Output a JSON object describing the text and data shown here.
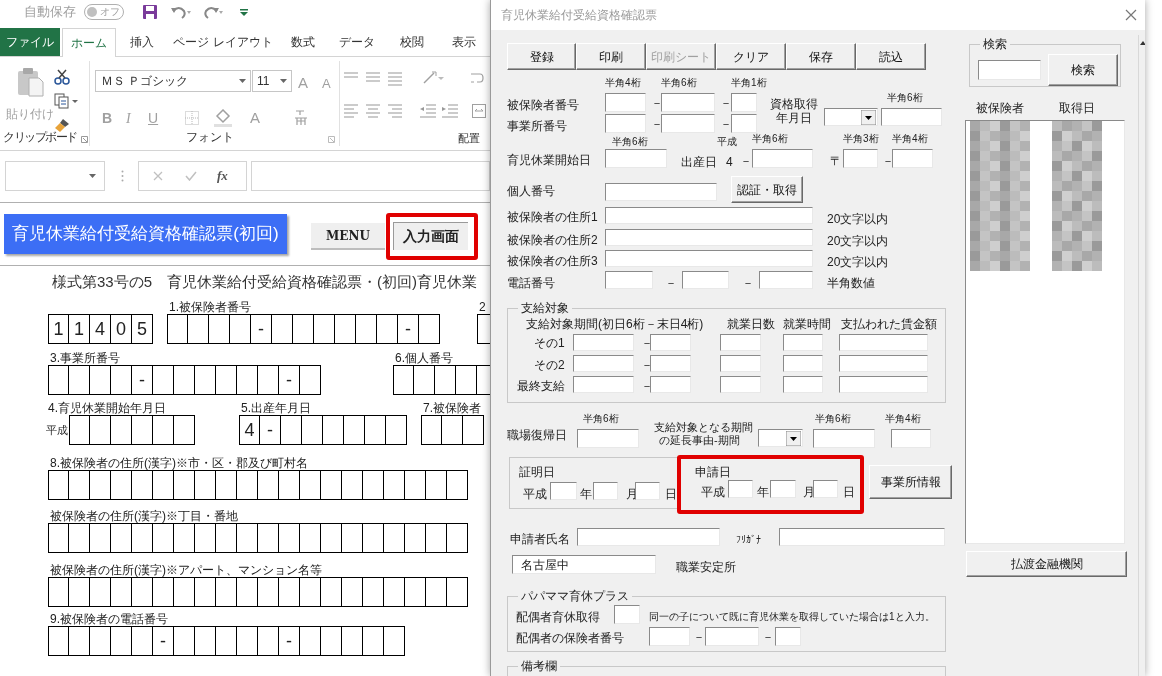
{
  "excel": {
    "quick_access": {
      "autosave_label": "自動保存",
      "autosave_toggle": {
        "label": "オフ",
        "on": false
      }
    },
    "tabs": [
      {
        "label": "ファイル",
        "kind": "file",
        "selected": false
      },
      {
        "label": "ホーム",
        "kind": "tab",
        "selected": true
      },
      {
        "label": "挿入",
        "kind": "tab",
        "selected": false
      },
      {
        "label": "ページ レイアウト",
        "kind": "tab",
        "selected": false
      },
      {
        "label": "数式",
        "kind": "tab",
        "selected": false
      },
      {
        "label": "データ",
        "kind": "tab",
        "selected": false
      },
      {
        "label": "校閲",
        "kind": "tab",
        "selected": false
      },
      {
        "label": "表示",
        "kind": "tab",
        "selected": false
      }
    ],
    "ribbon": {
      "paste_label": "貼り付け",
      "font_name": "ＭＳ Ｐゴシック",
      "font_size": "11",
      "grow_shrink": [
        "A",
        "A"
      ],
      "format_buttons": [
        "B",
        "I",
        "U"
      ],
      "font_color": "A",
      "group_labels": [
        "クリップボード",
        "フォント",
        "配置"
      ]
    },
    "formula_bar": {
      "fx": "fx"
    },
    "sheet": {
      "title_button": "育児休業給付受給資格確認票(初回)",
      "menu_button": "MENU",
      "input_button": "入力画面",
      "form_title": "様式第33号の5　育児休業給付受給資格確認票・(初回)育児休業",
      "rows": [
        {
          "groups": [
            {
              "cells": [
                "1",
                "1",
                "4",
                "0",
                "5"
              ]
            },
            {
              "label": "1.被保険者番号",
              "cells": [
                null,
                null,
                null,
                null,
                "-",
                null,
                null,
                null,
                null,
                null,
                null,
                "-",
                null
              ]
            },
            {
              "label": "2",
              "cells": [
                null
              ]
            }
          ]
        },
        {
          "groups": [
            {
              "label": "3.事業所番号",
              "cells": [
                null,
                null,
                null,
                null,
                "-",
                null,
                null,
                null,
                null,
                null,
                null,
                "-",
                null
              ]
            },
            {
              "label": "6.個人番号",
              "cells": [
                null,
                null,
                null,
                null,
                null
              ]
            }
          ]
        },
        {
          "groups": [
            {
              "label": "4.育児休業開始年月日",
              "prefix": "平成",
              "cells": [
                null,
                null,
                null,
                null,
                null,
                null
              ]
            },
            {
              "label": "5.出産年月日",
              "cells": [
                "4",
                "-",
                null,
                null,
                null,
                null,
                null,
                null
              ]
            },
            {
              "label": "7.被保険者",
              "cells": [
                null,
                null,
                null
              ]
            }
          ]
        },
        {
          "groups": [
            {
              "label": "8.被保険者の住所(漢字)※市・区・郡及び町村名",
              "cells": [
                null,
                null,
                null,
                null,
                null,
                null,
                null,
                null,
                null,
                null,
                null,
                null,
                null,
                null,
                null,
                null,
                null,
                null,
                null,
                null
              ]
            }
          ]
        },
        {
          "groups": [
            {
              "label": "被保険者の住所(漢字)※丁目・番地",
              "cells": [
                null,
                null,
                null,
                null,
                null,
                null,
                null,
                null,
                null,
                null,
                null,
                null,
                null,
                null,
                null,
                null,
                null,
                null,
                null,
                null
              ]
            }
          ]
        },
        {
          "groups": [
            {
              "label": "被保険者の住所(漢字)※アパート、マンション名等",
              "cells": [
                null,
                null,
                null,
                null,
                null,
                null,
                null,
                null,
                null,
                null,
                null,
                null,
                null,
                null,
                null,
                null,
                null,
                null,
                null,
                null
              ]
            }
          ]
        },
        {
          "groups": [
            {
              "label": "9.被保険者の電話番号",
              "cells": [
                null,
                null,
                null,
                null,
                null,
                "-",
                null,
                null,
                null,
                null,
                null,
                "-",
                null,
                null,
                null,
                null,
                null
              ]
            }
          ]
        }
      ]
    }
  },
  "dialog": {
    "title": "育児休業給付受給資格確認票",
    "controls": [
      {
        "kind": "button",
        "label": "登録",
        "disabled": false
      },
      {
        "kind": "button",
        "label": "印刷",
        "disabled": false
      },
      {
        "kind": "button",
        "label": "印刷シート",
        "disabled": true
      },
      {
        "kind": "button",
        "label": "クリア",
        "disabled": false
      },
      {
        "kind": "button",
        "label": "保存",
        "disabled": false
      },
      {
        "kind": "button",
        "label": "読込",
        "disabled": false
      },
      {
        "kind": "hint",
        "text": "半角4桁"
      },
      {
        "kind": "hint",
        "text": "半角6桁"
      },
      {
        "kind": "hint",
        "text": "半角1桁"
      },
      {
        "kind": "label",
        "text": "被保険者番号"
      },
      {
        "kind": "field"
      },
      {
        "kind": "label",
        "text": "－"
      },
      {
        "kind": "field"
      },
      {
        "kind": "label",
        "text": "－"
      },
      {
        "kind": "field"
      },
      {
        "kind": "label",
        "text": "事業所番号"
      },
      {
        "kind": "field"
      },
      {
        "kind": "label",
        "text": "－"
      },
      {
        "kind": "field"
      },
      {
        "kind": "label",
        "text": "－"
      },
      {
        "kind": "field"
      },
      {
        "kind": "label",
        "text": "資格取得"
      },
      {
        "kind": "label",
        "text": "年月日"
      },
      {
        "kind": "hint",
        "text": "半角6桁"
      },
      {
        "kind": "dropdown"
      },
      {
        "kind": "field"
      },
      {
        "kind": "hint",
        "text": "半角6桁"
      },
      {
        "kind": "hint",
        "text": "平成"
      },
      {
        "kind": "hint",
        "text": "半角6桁"
      },
      {
        "kind": "hint",
        "text": "半角3桁"
      },
      {
        "kind": "hint",
        "text": "半角4桁"
      },
      {
        "kind": "label",
        "text": "育児休業開始日"
      },
      {
        "kind": "field"
      },
      {
        "kind": "label",
        "text": "出産日"
      },
      {
        "kind": "label",
        "text": "4"
      },
      {
        "kind": "label",
        "text": "－"
      },
      {
        "kind": "field"
      },
      {
        "kind": "label",
        "text": "〒"
      },
      {
        "kind": "field"
      },
      {
        "kind": "label",
        "text": "－"
      },
      {
        "kind": "field"
      },
      {
        "kind": "label",
        "text": "個人番号"
      },
      {
        "kind": "field"
      },
      {
        "kind": "button",
        "label": "認証・取得",
        "disabled": false
      },
      {
        "kind": "label",
        "text": "被保険者の住所1"
      },
      {
        "kind": "field"
      },
      {
        "kind": "label",
        "text": "20文字以内"
      },
      {
        "kind": "label",
        "text": "被保険者の住所2"
      },
      {
        "kind": "field"
      },
      {
        "kind": "label",
        "text": "20文字以内"
      },
      {
        "kind": "label",
        "text": "被保険者の住所3"
      },
      {
        "kind": "field"
      },
      {
        "kind": "label",
        "text": "20文字以内"
      },
      {
        "kind": "label",
        "text": "電話番号"
      },
      {
        "kind": "field"
      },
      {
        "kind": "label",
        "text": "－"
      },
      {
        "kind": "field"
      },
      {
        "kind": "label",
        "text": "－"
      },
      {
        "kind": "field"
      },
      {
        "kind": "label",
        "text": "半角数値"
      },
      {
        "kind": "frame",
        "legend": "支給対象"
      },
      {
        "kind": "label",
        "text": "支給対象期間(初日6桁－末日4桁)"
      },
      {
        "kind": "label",
        "text": "就業日数"
      },
      {
        "kind": "label",
        "text": "就業時間"
      },
      {
        "kind": "label",
        "text": "支払われた賃金額"
      },
      {
        "kind": "label",
        "text": "その1"
      },
      {
        "kind": "field"
      },
      {
        "kind": "label",
        "text": "－"
      },
      {
        "kind": "field"
      },
      {
        "kind": "field"
      },
      {
        "kind": "field"
      },
      {
        "kind": "field"
      },
      {
        "kind": "label",
        "text": "その2"
      },
      {
        "kind": "field"
      },
      {
        "kind": "label",
        "text": "－"
      },
      {
        "kind": "field"
      },
      {
        "kind": "field"
      },
      {
        "kind": "field"
      },
      {
        "kind": "field"
      },
      {
        "kind": "label",
        "text": "最終支給"
      },
      {
        "kind": "field"
      },
      {
        "kind": "label",
        "text": "－"
      },
      {
        "kind": "field"
      },
      {
        "kind": "field"
      },
      {
        "kind": "field"
      },
      {
        "kind": "field"
      },
      {
        "kind": "label",
        "text": "職場復帰日"
      },
      {
        "kind": "hint",
        "text": "半角6桁"
      },
      {
        "kind": "field"
      },
      {
        "kind": "caption",
        "text": "支給対象となる期間"
      },
      {
        "kind": "caption",
        "text": "の延長事由-期間"
      },
      {
        "kind": "dropdown"
      },
      {
        "kind": "hint",
        "text": "半角6桁"
      },
      {
        "kind": "field"
      },
      {
        "kind": "hint",
        "text": "半角4桁"
      },
      {
        "kind": "field"
      },
      {
        "kind": "panel"
      },
      {
        "kind": "label",
        "text": "証明日"
      },
      {
        "kind": "label",
        "text": "平成"
      },
      {
        "kind": "field"
      },
      {
        "kind": "label",
        "text": "年"
      },
      {
        "kind": "field"
      },
      {
        "kind": "label",
        "text": "月"
      },
      {
        "kind": "field"
      },
      {
        "kind": "label",
        "text": "日"
      },
      {
        "kind": "label",
        "text": "申請日"
      },
      {
        "kind": "label",
        "text": "平成"
      },
      {
        "kind": "field"
      },
      {
        "kind": "label",
        "text": "年"
      },
      {
        "kind": "field"
      },
      {
        "kind": "label",
        "text": "月"
      },
      {
        "kind": "field"
      },
      {
        "kind": "label",
        "text": "日"
      },
      {
        "kind": "button",
        "label": "事業所情報",
        "disabled": false
      },
      {
        "kind": "label",
        "text": "申請者氏名"
      },
      {
        "kind": "field"
      },
      {
        "kind": "hint",
        "text": "ﾌﾘｶﾞﾅ"
      },
      {
        "kind": "field"
      },
      {
        "kind": "field",
        "value": "名古屋中"
      },
      {
        "kind": "label",
        "text": "職業安定所"
      },
      {
        "kind": "frame",
        "legend": "パパママ育休プラス"
      },
      {
        "kind": "label",
        "text": "配偶者育休取得"
      },
      {
        "kind": "field"
      },
      {
        "kind": "note",
        "text": "同一の子について既に育児休業を取得していた場合は1と入力。"
      },
      {
        "kind": "label",
        "text": "配偶者の保険者番号"
      },
      {
        "kind": "field"
      },
      {
        "kind": "label",
        "text": "－"
      },
      {
        "kind": "field"
      },
      {
        "kind": "label",
        "text": "－"
      },
      {
        "kind": "field"
      },
      {
        "kind": "frame",
        "legend": "備考欄"
      },
      {
        "kind": "frame",
        "legend": "検索"
      },
      {
        "kind": "field"
      },
      {
        "kind": "button",
        "label": "検索",
        "disabled": false
      },
      {
        "kind": "label",
        "text": "被保険者"
      },
      {
        "kind": "label",
        "text": "取得日"
      },
      {
        "kind": "list"
      },
      {
        "kind": "button",
        "label": "払渡金融機関",
        "disabled": false
      }
    ]
  }
}
